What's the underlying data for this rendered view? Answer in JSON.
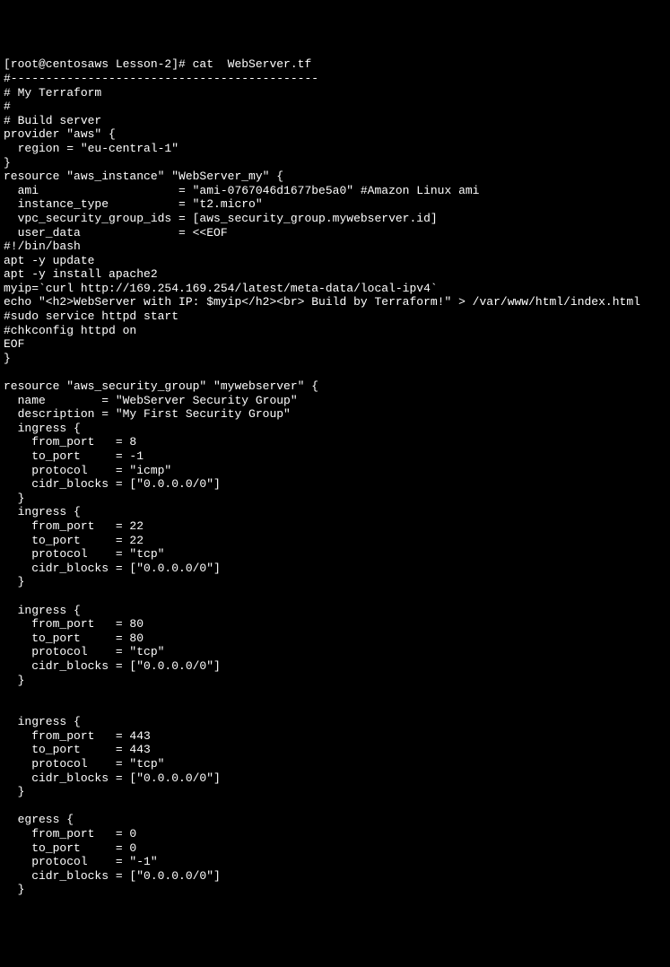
{
  "terminal": {
    "lines": [
      "[root@centosaws Lesson-2]# cat  WebServer.tf",
      "#--------------------------------------------",
      "# My Terraform",
      "#",
      "# Build server",
      "provider \"aws\" {",
      "  region = \"eu-central-1\"",
      "}",
      "resource \"aws_instance\" \"WebServer_my\" {",
      "  ami                    = \"ami-0767046d1677be5a0\" #Amazon Linux ami",
      "  instance_type          = \"t2.micro\"",
      "  vpc_security_group_ids = [aws_security_group.mywebserver.id]",
      "  user_data              = <<EOF",
      "#!/bin/bash",
      "apt -y update",
      "apt -y install apache2",
      "myip=`curl http://169.254.169.254/latest/meta-data/local-ipv4`",
      "echo \"<h2>WebServer with IP: $myip</h2><br> Build by Terraform!\" > /var/www/html/index.html",
      "#sudo service httpd start",
      "#chkconfig httpd on",
      "EOF",
      "}",
      "",
      "resource \"aws_security_group\" \"mywebserver\" {",
      "  name        = \"WebServer Security Group\"",
      "  description = \"My First Security Group\"",
      "  ingress {",
      "    from_port   = 8",
      "    to_port     = -1",
      "    protocol    = \"icmp\"",
      "    cidr_blocks = [\"0.0.0.0/0\"]",
      "  }",
      "  ingress {",
      "    from_port   = 22",
      "    to_port     = 22",
      "    protocol    = \"tcp\"",
      "    cidr_blocks = [\"0.0.0.0/0\"]",
      "  }",
      "",
      "  ingress {",
      "    from_port   = 80",
      "    to_port     = 80",
      "    protocol    = \"tcp\"",
      "    cidr_blocks = [\"0.0.0.0/0\"]",
      "  }",
      "",
      "",
      "  ingress {",
      "    from_port   = 443",
      "    to_port     = 443",
      "    protocol    = \"tcp\"",
      "    cidr_blocks = [\"0.0.0.0/0\"]",
      "  }",
      "",
      "  egress {",
      "    from_port   = 0",
      "    to_port     = 0",
      "    protocol    = \"-1\"",
      "    cidr_blocks = [\"0.0.0.0/0\"]",
      "  }"
    ]
  }
}
